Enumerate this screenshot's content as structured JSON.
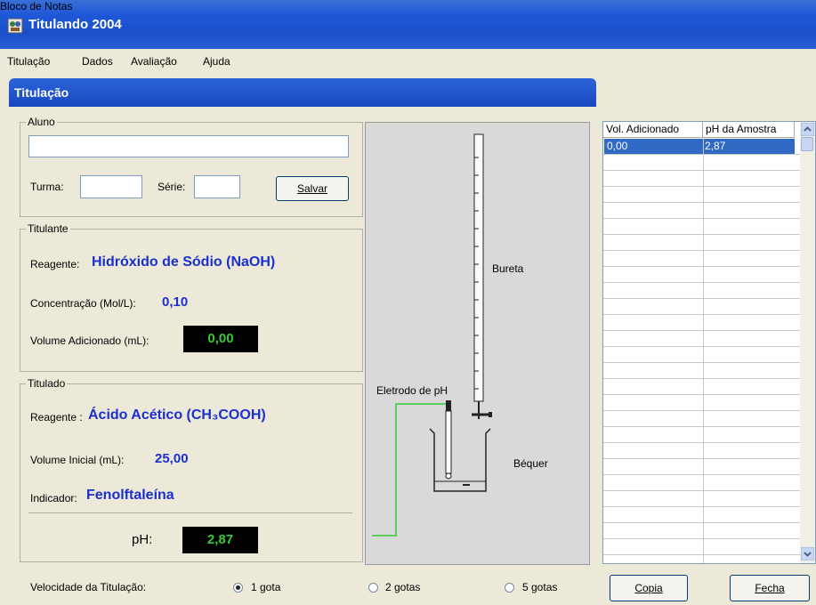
{
  "window": {
    "title": "Titulando 2004"
  },
  "menu": [
    "Titulação",
    "Dados",
    "Avaliação",
    "Ajuda"
  ],
  "titulacao_panel": {
    "title": "Titulação",
    "aluno": {
      "legend": "Aluno",
      "name_value": "",
      "turma_label": "Turma:",
      "turma_value": "",
      "serie_label": "Série:",
      "serie_value": "",
      "save_label": "Salvar"
    },
    "titulante": {
      "legend": "Titulante",
      "reagente_label": "Reagente:",
      "reagente_value": "Hidróxido de Sódio (NaOH)",
      "concentracao_label": "Concentração (Mol/L):",
      "concentracao_value": "0,10",
      "volume_label": "Volume Adicionado (mL):",
      "volume_value": "0,00"
    },
    "titulado": {
      "legend": "Titulado",
      "reagente_label": "Reagente :",
      "reagente_value": "Ácido Acético (CH₃COOH)",
      "volume_label": "Volume Inicial (mL):",
      "volume_value": "25,00",
      "indicador_label": "Indicador:",
      "indicador_value": "Fenolftaleína",
      "ph_label": "pH:",
      "ph_value": "2,87"
    },
    "apparatus": {
      "bureta_label": "Bureta",
      "eletrodo_label": "Eletrodo de pH",
      "bequer_label": "Béquer"
    },
    "velocidade": {
      "label": "Velocidade da Titulação:",
      "options": [
        "1 gota",
        "2 gotas",
        "5 gotas"
      ],
      "selected": "1 gota"
    }
  },
  "notes_panel": {
    "title": "Bloco de Notas",
    "columns": [
      "Vol. Adicionado",
      "pH da Amostra"
    ],
    "rows": [
      [
        "0,00",
        "2,87"
      ]
    ],
    "copy_label": "Copia",
    "close_label": "Fecha"
  },
  "colors": {
    "titlebar": "#1f58d8",
    "lcd_text": "#33cc33",
    "value_blue": "#1a2fd0",
    "selection": "#316ac5",
    "electrode_wire": "#33cc33"
  }
}
